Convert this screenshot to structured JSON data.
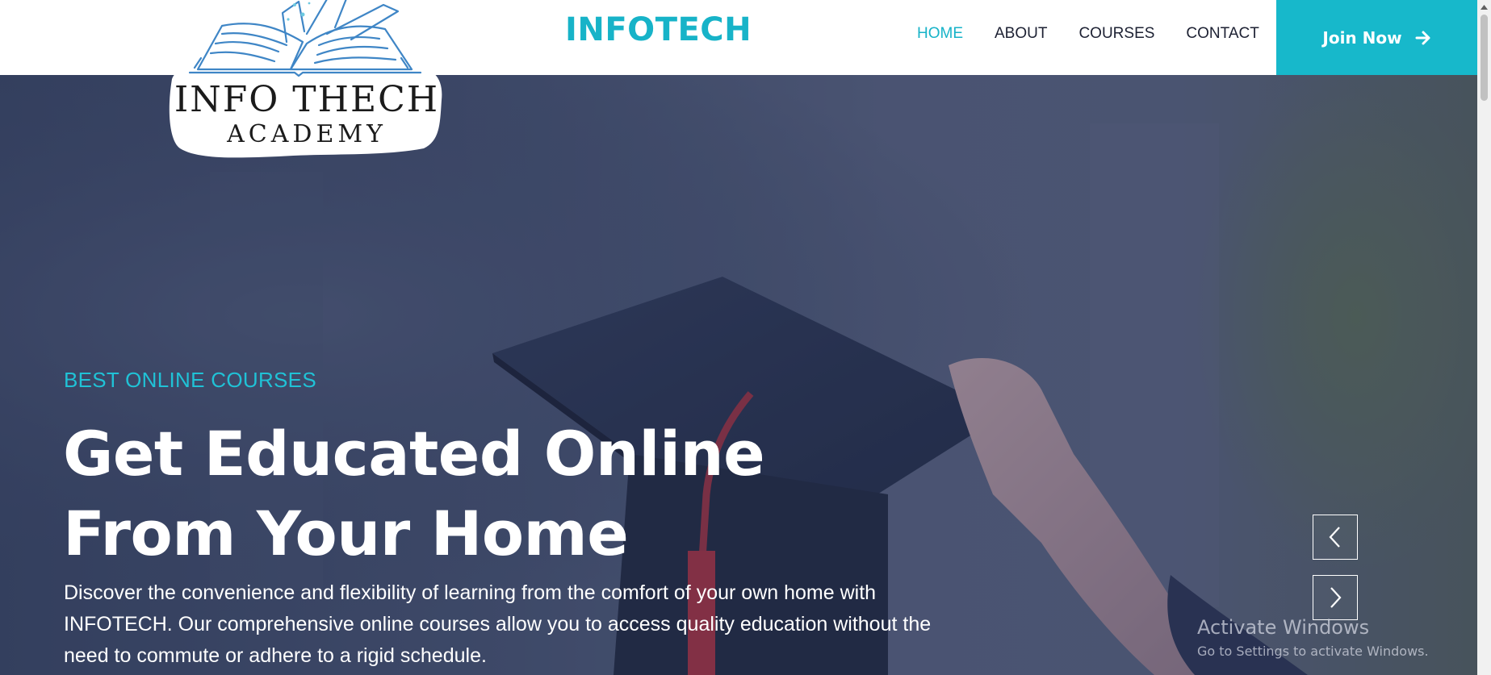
{
  "header": {
    "brand": "INFOTECH",
    "nav": [
      {
        "label": "HOME",
        "active": true
      },
      {
        "label": "ABOUT",
        "active": false
      },
      {
        "label": "COURSES",
        "active": false
      },
      {
        "label": "CONTACT",
        "active": false
      }
    ],
    "join_button": {
      "label": "Join Now",
      "icon": "arrow-right-icon"
    }
  },
  "logo": {
    "line1": "INFO THECH",
    "line2": "ACADEMY",
    "icon": "open-book-icon"
  },
  "hero": {
    "eyebrow": "BEST ONLINE COURSES",
    "headline": "Get Educated Online From Your Home",
    "description": "Discover the convenience and flexibility of learning from the comfort of your own home with INFOTECH. Our comprehensive online courses allow you to access quality education without the need to commute or adhere to a rigid schedule.",
    "carousel": {
      "prev_icon": "chevron-left-icon",
      "next_icon": "chevron-right-icon"
    }
  },
  "watermark": {
    "title": "Activate Windows",
    "subtitle": "Go to Settings to activate Windows."
  },
  "colors": {
    "accent": "#17b8cb",
    "nav_text": "#1d2133",
    "hero_overlay": "#3a4663"
  }
}
